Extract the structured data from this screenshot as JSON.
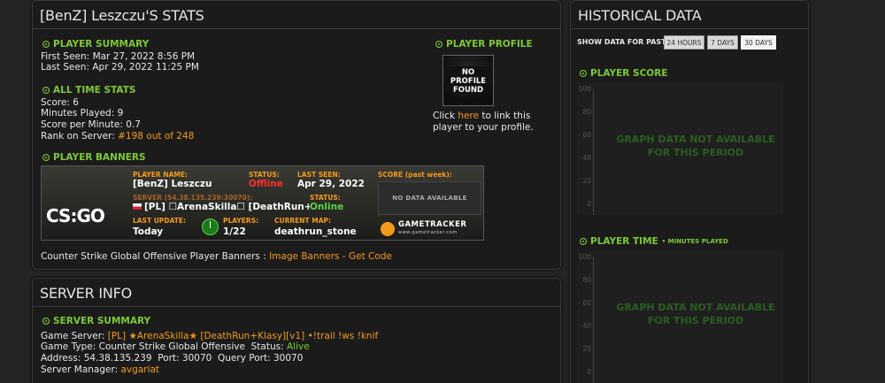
{
  "stats_panel": {
    "title": "[BenZ] Leszczu'S STATS",
    "player_summary": {
      "heading": "PLAYER SUMMARY",
      "first_seen_label": "First Seen:",
      "first_seen": "Mar 27, 2022 8:56 PM",
      "last_seen_label": "Last Seen:",
      "last_seen": "Apr 29, 2022 11:25 PM"
    },
    "all_time_stats": {
      "heading": "ALL TIME STATS",
      "score_label": "Score:",
      "score": "6",
      "minutes_label": "Minutes Played:",
      "minutes": "9",
      "spm_label": "Score per Minute:",
      "spm": "0.7",
      "rank_label": "Rank on Server:",
      "rank": "#198 out of 248"
    },
    "player_profile": {
      "heading": "PLAYER PROFILE",
      "avatar_text": "NO PROFILE FOUND",
      "click_text": "Click",
      "here_link": "here",
      "link_rest": "to link this",
      "link_rest2": "player to your profile."
    },
    "player_banners": {
      "heading": "PLAYER BANNERS",
      "banner": {
        "logo": "CS:GO",
        "player_name_label": "PLAYER NAME:",
        "player_name": "[BenZ] Leszczu",
        "status_label": "STATUS:",
        "status": "Offline",
        "last_seen_label": "LAST SEEN:",
        "last_seen": "Apr 29, 2022",
        "score_label": "SCORE (past week):",
        "no_data": "NO DATA AVAILABLE",
        "server_label": "SERVER (54.38.135.239:30070):",
        "server_status_label": "STATUS:",
        "server_name": "[PL] ☐ArenaSkilla☐ [DeathRun+",
        "server_status": "Online",
        "last_update_label": "LAST UPDATE:",
        "last_update": "Today",
        "players_label": "PLAYERS:",
        "players": "1/22",
        "map_label": "CURRENT MAP:",
        "map": "deathrun_stone",
        "gt_name": "GAMETRACKER",
        "gt_url": "www.gametracker.com"
      },
      "footer_text": "Counter Strike Global Offensive Player Banners :",
      "footer_link": "Image Banners - Get Code"
    }
  },
  "server_panel": {
    "title": "SERVER INFO",
    "heading": "SERVER SUMMARY",
    "game_server_label": "Game Server:",
    "game_server": "[PL] ★ArenaSkilla★ [DeathRun+Klasy][v1] •!trail !ws !knif",
    "game_type_label": "Game Type:",
    "game_type": "Counter Strike Global Offensive",
    "status_label": "Status:",
    "status": "Alive",
    "address_label": "Address:",
    "address": "54.38.135.239",
    "port_label": "Port:",
    "port": "30070",
    "query_port_label": "Query Port:",
    "query_port": "30070",
    "manager_label": "Server Manager:",
    "manager": "avgariat"
  },
  "historical_panel": {
    "title": "HISTORICAL DATA",
    "show_data_label": "SHOW DATA FOR PAST:",
    "buttons": [
      "24 HOURS",
      "7 DAYS",
      "30 DAYS"
    ],
    "player_score_heading": "PLAYER SCORE",
    "player_time_heading": "PLAYER TIME",
    "player_time_sub": "• MINUTES PLAYED",
    "ticks": [
      "100",
      "80",
      "60",
      "40",
      "20",
      "0"
    ],
    "na_line1": "GRAPH DATA NOT AVAILABLE",
    "na_line2": "FOR THIS PERIOD"
  }
}
